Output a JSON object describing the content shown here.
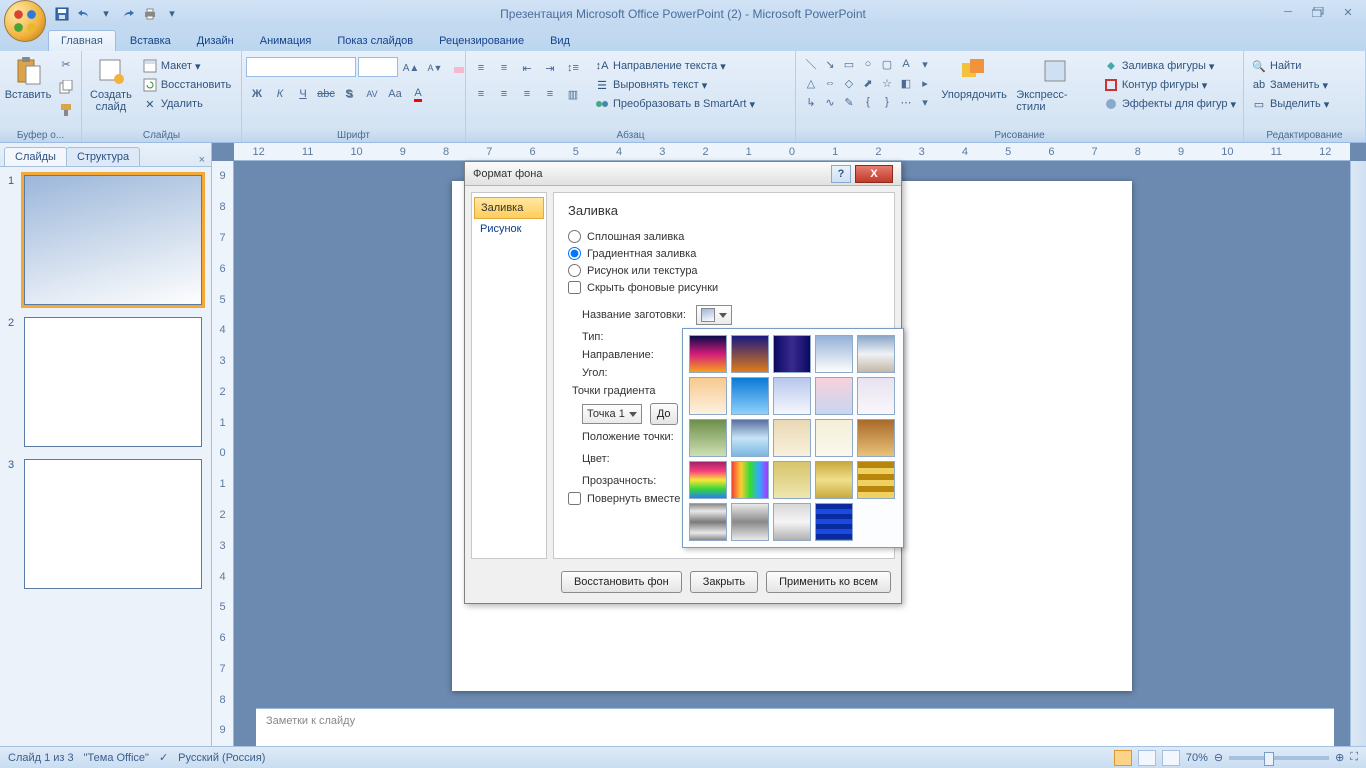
{
  "title": "Презентация Microsoft Office PowerPoint (2) - Microsoft PowerPoint",
  "ribbon_tabs": [
    "Главная",
    "Вставка",
    "Дизайн",
    "Анимация",
    "Показ слайдов",
    "Рецензирование",
    "Вид"
  ],
  "ribbon": {
    "clipboard": {
      "paste": "Вставить",
      "label": "Буфер о..."
    },
    "slides": {
      "new": "Создать\nслайд",
      "layout": "Макет",
      "reset": "Восстановить",
      "delete": "Удалить",
      "label": "Слайды"
    },
    "font": {
      "label": "Шрифт"
    },
    "paragraph": {
      "textdir": "Направление текста",
      "align": "Выровнять текст",
      "smartart": "Преобразовать в SmartArt",
      "label": "Абзац"
    },
    "drawing": {
      "arrange": "Упорядочить",
      "styles": "Экспресс-стили",
      "fill": "Заливка фигуры",
      "outline": "Контур фигуры",
      "effects": "Эффекты для фигур",
      "label": "Рисование"
    },
    "editing": {
      "find": "Найти",
      "replace": "Заменить",
      "select": "Выделить",
      "label": "Редактирование"
    }
  },
  "side_tabs": {
    "slides": "Слайды",
    "outline": "Структура"
  },
  "thumbs": [
    "1",
    "2",
    "3"
  ],
  "ruler_numbers_h": [
    "12",
    "11",
    "10",
    "9",
    "8",
    "7",
    "6",
    "5",
    "4",
    "3",
    "2",
    "1",
    "0",
    "1",
    "2",
    "3",
    "4",
    "5",
    "6",
    "7",
    "8",
    "9",
    "10",
    "11",
    "12"
  ],
  "ruler_numbers_v": [
    "9",
    "8",
    "7",
    "6",
    "5",
    "4",
    "3",
    "2",
    "1",
    "0",
    "1",
    "2",
    "3",
    "4",
    "5",
    "6",
    "7",
    "8",
    "9"
  ],
  "notes_placeholder": "Заметки к слайду",
  "status": {
    "slide": "Слайд 1 из 3",
    "theme": "\"Тема Office\"",
    "lang": "Русский (Россия)",
    "zoom": "70%"
  },
  "dialog": {
    "title": "Формат фона",
    "side": {
      "fill": "Заливка",
      "picture": "Рисунок"
    },
    "heading": "Заливка",
    "opt_solid": "Сплошная заливка",
    "opt_gradient": "Градиентная заливка",
    "opt_picture": "Рисунок или текстура",
    "chk_hide": "Скрыть фоновые рисунки",
    "lbl_preset": "Название заготовки:",
    "lbl_type": "Тип:",
    "lbl_direction": "Направление:",
    "lbl_angle": "Угол:",
    "lbl_stops": "Точки градиента",
    "stop_value": "Точка 1",
    "btn_addstop": "До",
    "lbl_stoppos": "Положение точки:",
    "lbl_color": "Цвет:",
    "lbl_transparency": "Прозрачность:",
    "chk_rotate": "Повернуть вместе с фигурой",
    "btn_reset": "Восстановить фон",
    "btn_close": "Закрыть",
    "btn_applyall": "Применить ко всем"
  }
}
